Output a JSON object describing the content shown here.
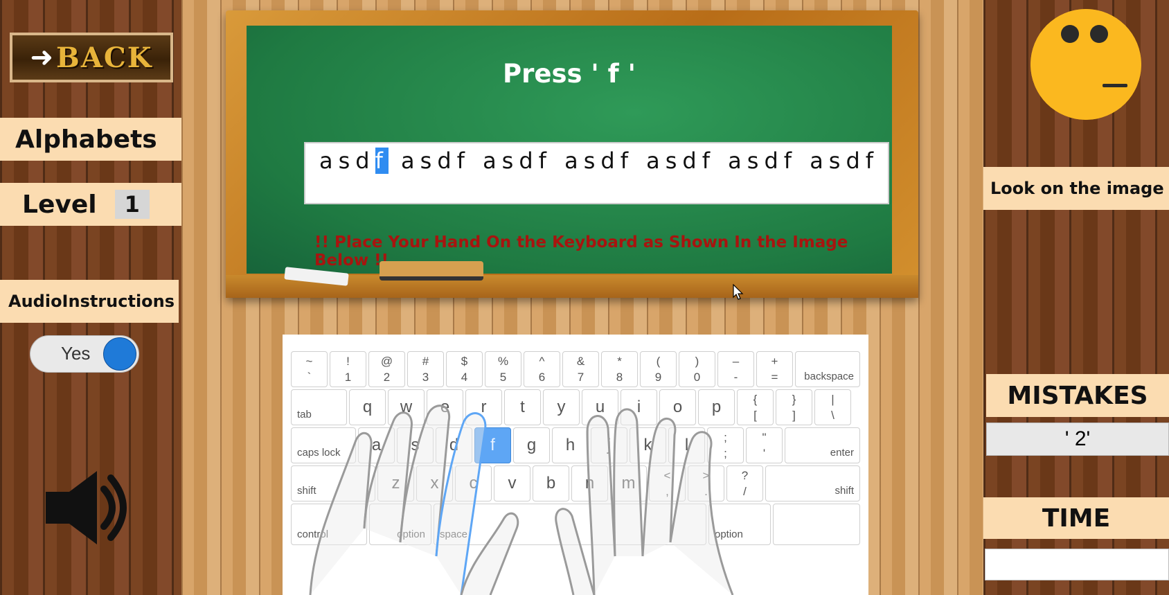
{
  "nav": {
    "back_label": "BACK"
  },
  "left_panel": {
    "category": "Alphabets",
    "level_label": "Level",
    "level_value": "1",
    "audio_label": "AudioInstructions",
    "audio_toggle": "Yes"
  },
  "board": {
    "prompt": "Press ' f '",
    "practice_before": "asd",
    "practice_current": "f",
    "practice_after": " asdf asdf asdf asdf asdf asdf",
    "instruction": "!! Place Your Hand On the Keyboard as Shown In the Image Below !!"
  },
  "keyboard": {
    "highlight_key": "f",
    "row1": [
      [
        "~",
        "`"
      ],
      [
        "!",
        "1"
      ],
      [
        "@",
        "2"
      ],
      [
        "#",
        "3"
      ],
      [
        "$",
        "4"
      ],
      [
        "%",
        "5"
      ],
      [
        "^",
        "6"
      ],
      [
        "&",
        "7"
      ],
      [
        "*",
        "8"
      ],
      [
        "(",
        "9"
      ],
      [
        ")",
        "0"
      ],
      [
        "–",
        "-"
      ],
      [
        "+",
        "="
      ]
    ],
    "row2": [
      "q",
      "w",
      "e",
      "r",
      "t",
      "y",
      "u",
      "i",
      "o",
      "p"
    ],
    "row2_sym": [
      [
        "{",
        "["
      ],
      [
        "}",
        "]"
      ],
      [
        "|",
        "\\"
      ]
    ],
    "row3": [
      "a",
      "s",
      "d",
      "f",
      "g",
      "h",
      "j",
      "k",
      "l"
    ],
    "row3_sym": [
      [
        ";",
        ";"
      ],
      [
        "\"",
        "'"
      ]
    ],
    "row4": [
      "z",
      "x",
      "c",
      "v",
      "b",
      "n",
      "m"
    ],
    "row4_sym": [
      [
        "<",
        ","
      ],
      [
        ">",
        "."
      ],
      [
        "?",
        "/"
      ]
    ],
    "mods": {
      "backspace": "backspace",
      "tab": "tab",
      "caps": "caps lock",
      "enter": "enter",
      "shift": "shift",
      "control": "control",
      "option": "option",
      "space": "space"
    }
  },
  "right_panel": {
    "hint": "Look on the image",
    "mistakes_label": "MISTAKES",
    "mistakes_value": "' 2'",
    "time_label": "TIME",
    "time_value": ""
  },
  "colors": {
    "highlight": "#2f8cf1",
    "board": "#1f7a42",
    "plank": "#fbdcb1",
    "face": "#fbb81f"
  }
}
